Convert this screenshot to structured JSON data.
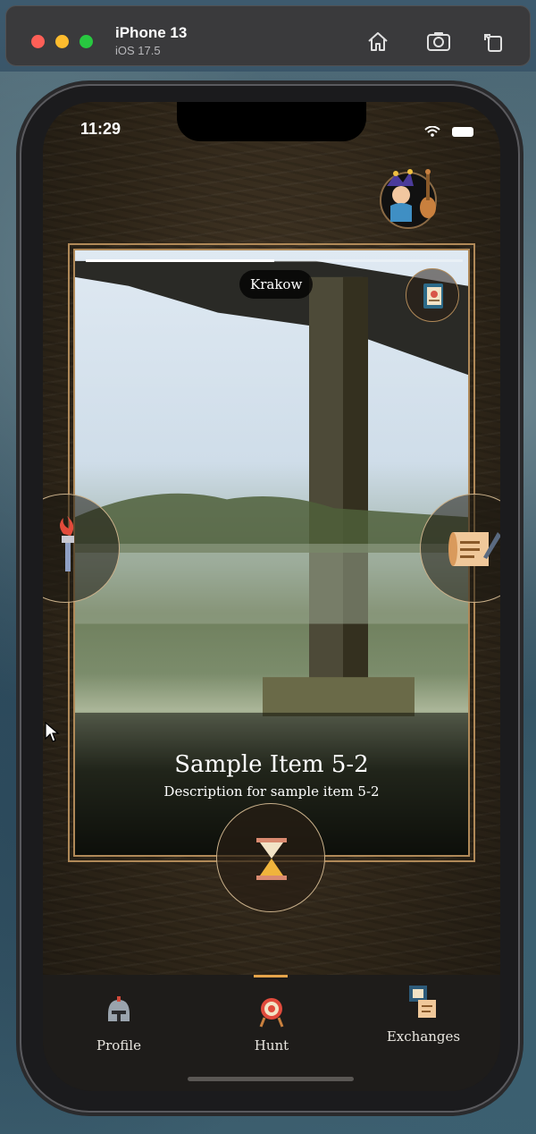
{
  "simulator": {
    "device_name": "iPhone 13",
    "os_version": "iOS 17.5",
    "toolbar_icons": [
      "home-icon",
      "screenshot-icon",
      "rotate-icon"
    ]
  },
  "status_bar": {
    "time": "11:29",
    "icons": [
      "wifi-icon",
      "battery-icon"
    ]
  },
  "header": {
    "avatar_icon": "jester-bard-avatar-icon"
  },
  "card": {
    "location": "Krakow",
    "progress": 0.5,
    "action_icon": "storybook-icon",
    "title": "Sample Item 5-2",
    "description": "Description for sample item 5-2"
  },
  "side_buttons": {
    "left_icon": "torch-icon",
    "right_icon": "scroll-quill-icon"
  },
  "center_button": {
    "icon": "hourglass-icon"
  },
  "tabbar": {
    "active": "Hunt",
    "tabs": [
      {
        "label": "Profile",
        "icon": "helmet-icon"
      },
      {
        "label": "Hunt",
        "icon": "target-icon"
      },
      {
        "label": "Exchanges",
        "icon": "exchange-scroll-icon"
      }
    ]
  },
  "colors": {
    "accent": "#e5a44a",
    "frame": "#b08958",
    "tabbar_bg": "#1e1c1a"
  }
}
